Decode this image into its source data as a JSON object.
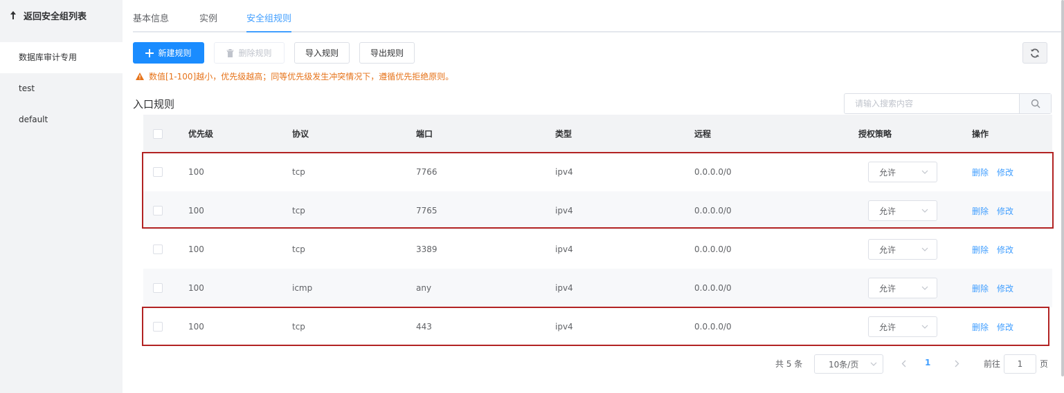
{
  "sidebar": {
    "back_label": "返回安全组列表",
    "groups": [
      {
        "label": "数据库审计专用",
        "active": true
      },
      {
        "label": "test",
        "active": false
      },
      {
        "label": "default",
        "active": false
      }
    ]
  },
  "tabs": [
    {
      "label": "基本信息",
      "active": false
    },
    {
      "label": "实例",
      "active": false
    },
    {
      "label": "安全组规则",
      "active": true
    }
  ],
  "toolbar": {
    "new_rule": "新建规则",
    "delete_rule": "删除规则",
    "import_rule": "导入规则",
    "export_rule": "导出规则"
  },
  "warning": "数值[1-100]越小，优先级越高；同等优先级发生冲突情况下，遵循优先拒绝原则。",
  "section_title": "入口规则",
  "search": {
    "placeholder": "请输入搜索内容"
  },
  "table": {
    "headers": {
      "priority": "优先级",
      "protocol": "协议",
      "port": "端口",
      "type": "类型",
      "remote": "远程",
      "policy": "授权策略",
      "actions": "操作"
    },
    "rows": [
      {
        "priority": "100",
        "protocol": "tcp",
        "port": "7766",
        "type": "ipv4",
        "remote": "0.0.0.0/0",
        "policy": "允许",
        "delete": "删除",
        "edit": "修改"
      },
      {
        "priority": "100",
        "protocol": "tcp",
        "port": "7765",
        "type": "ipv4",
        "remote": "0.0.0.0/0",
        "policy": "允许",
        "delete": "删除",
        "edit": "修改"
      },
      {
        "priority": "100",
        "protocol": "tcp",
        "port": "3389",
        "type": "ipv4",
        "remote": "0.0.0.0/0",
        "policy": "允许",
        "delete": "删除",
        "edit": "修改"
      },
      {
        "priority": "100",
        "protocol": "icmp",
        "port": "any",
        "type": "ipv4",
        "remote": "0.0.0.0/0",
        "policy": "允许",
        "delete": "删除",
        "edit": "修改"
      },
      {
        "priority": "100",
        "protocol": "tcp",
        "port": "443",
        "type": "ipv4",
        "remote": "0.0.0.0/0",
        "policy": "允许",
        "delete": "删除",
        "edit": "修改"
      }
    ]
  },
  "pagination": {
    "total": "共 5 条",
    "page_size": "10条/页",
    "current_page": "1",
    "goto_label": "前往",
    "goto_value": "1",
    "page_suffix": "页"
  },
  "colors": {
    "primary": "#1a8cff",
    "warning": "#e6731a",
    "highlight": "#b22222",
    "link": "#409eff"
  }
}
